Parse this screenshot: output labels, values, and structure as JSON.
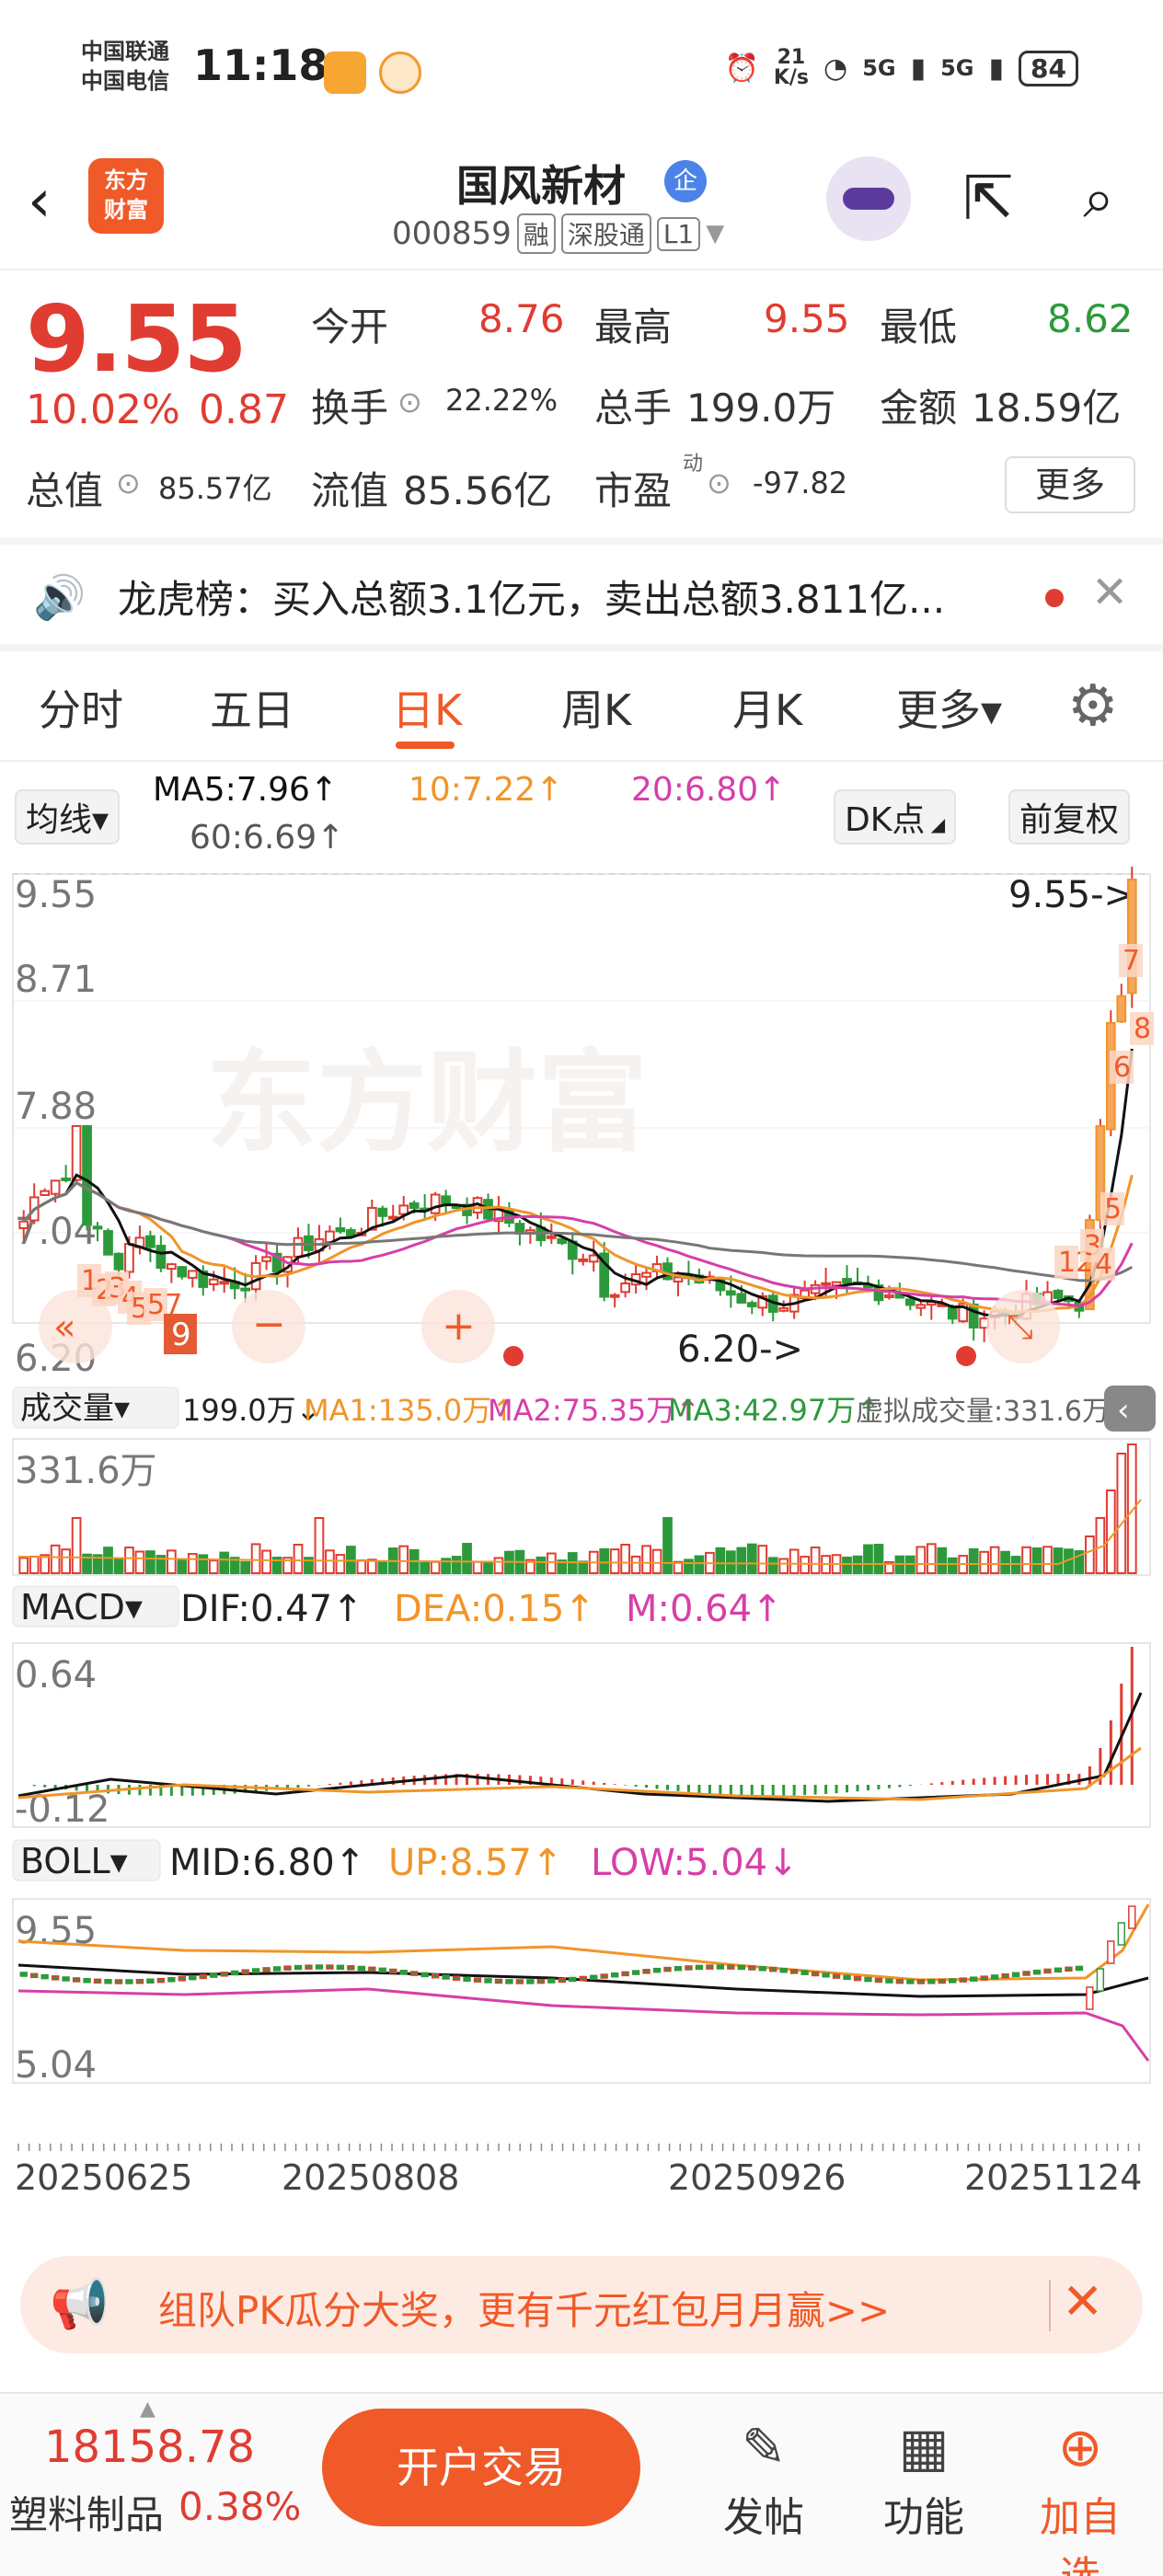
{
  "status_bar": {
    "carrier1": "中国联通",
    "carrier2": "中国电信",
    "time": "11:18",
    "speed_value": "21",
    "speed_unit": "K/s",
    "signal1": "5G",
    "signal2": "5G",
    "battery": "84"
  },
  "header": {
    "logo_line1": "东方",
    "logo_line2": "财富",
    "stock_name": "国风新材",
    "name_badge": "企",
    "code": "000859",
    "tags": [
      "融",
      "深股通",
      "L1"
    ]
  },
  "quote": {
    "price": "9.55",
    "change_pct": "10.02%",
    "change_amt": "0.87",
    "open_label": "今开",
    "open_value": "8.76",
    "high_label": "最高",
    "high_value": "9.55",
    "low_label": "最低",
    "low_value": "8.62",
    "turnover_label": "换手",
    "turnover_value": "22.22%",
    "volume_label": "总手",
    "volume_value": "199.0万",
    "amount_label": "金额",
    "amount_value": "18.59亿",
    "mktcap_label": "总值",
    "mktcap_value": "85.57亿",
    "float_label": "流值",
    "float_value": "85.56亿",
    "pe_label": "市盈",
    "pe_sup": "动",
    "pe_value": "-97.82",
    "more_label": "更多"
  },
  "ticker": {
    "text": "龙虎榜：买入总额3.1亿元，卖出总额3.811亿..."
  },
  "tabs": [
    {
      "label": "分时"
    },
    {
      "label": "五日"
    },
    {
      "label": "日K",
      "active": true
    },
    {
      "label": "周K"
    },
    {
      "label": "月K"
    },
    {
      "label": "更多▾"
    }
  ],
  "kline_header": {
    "indicator": "均线▾",
    "ma5": "MA5:7.96↑",
    "ma10": "10:7.22↑",
    "ma20": "20:6.80↑",
    "ma60": "60:6.69↑",
    "dk_button": "DK点",
    "adjust_button": "前复权"
  },
  "colors": {
    "up": "#e03c31",
    "down": "#2c9a3a",
    "ma5": "#111111",
    "ma10": "#f0952a",
    "ma20": "#d63fa8",
    "ma60": "#777777",
    "brand": "#f05a28"
  },
  "chart_data": [
    {
      "type": "candlestick",
      "title": "",
      "ylim": [
        6.2,
        9.55
      ],
      "y_ticks": [
        "9.55",
        "8.71",
        "7.88",
        "7.04",
        "6.20"
      ],
      "high_marker": "9.55->",
      "low_marker": "6.20->",
      "dk_points": [
        "1",
        "2",
        "3",
        "4",
        "5",
        "6",
        "7",
        "8",
        "9",
        "12",
        "34",
        "57"
      ],
      "watermark": "东方财富",
      "series": [
        {
          "name": "MA5",
          "last": 7.96
        },
        {
          "name": "MA10",
          "last": 7.22
        },
        {
          "name": "MA20",
          "last": 6.8
        },
        {
          "name": "MA60",
          "last": 6.69
        }
      ],
      "last_candles": [
        {
          "label": "4",
          "close": 7.01
        },
        {
          "label": "5",
          "close": 7.71
        },
        {
          "label": "6",
          "close": 8.48
        },
        {
          "label": "7",
          "close": 8.68
        },
        {
          "label": "8",
          "close": 9.55
        }
      ]
    },
    {
      "type": "bar",
      "name": "成交量",
      "header_label": "成交量▾",
      "value_label": "199.0万↓",
      "ma1": "MA1:135.0万↑",
      "ma2": "MA2:75.35万↑",
      "ma3": "MA3:42.97万↑",
      "virtual": "虚拟成交量:331.6万",
      "y_max_label": "331.6万",
      "ylim": [
        0,
        331.6
      ]
    },
    {
      "type": "line",
      "name": "MACD",
      "header_label": "MACD▾",
      "dif": "DIF:0.47↑",
      "dea": "DEA:0.15↑",
      "m": "M:0.64↑",
      "y_max_label": "0.64",
      "y_min_label": "-0.12",
      "ylim": [
        -0.12,
        0.64
      ]
    },
    {
      "type": "line",
      "name": "BOLL",
      "header_label": "BOLL▾",
      "mid": "MID:6.80↑",
      "up": "UP:8.57↑",
      "low": "LOW:5.04↓",
      "y_max_label": "9.55",
      "y_min_label": "5.04",
      "ylim": [
        5.04,
        9.55
      ],
      "x_labels": [
        "20250625",
        "20250808",
        "20250926",
        "20251124"
      ]
    }
  ],
  "banner": {
    "text": "组队PK瓜分大奖，更有千元红包月月赢>>"
  },
  "footer": {
    "index_value": "18158.78",
    "index_name": "塑料制品",
    "index_pct": "0.38%",
    "trade_label": "开户交易",
    "post_label": "发帖",
    "func_label": "功能",
    "add_label": "加自选"
  }
}
